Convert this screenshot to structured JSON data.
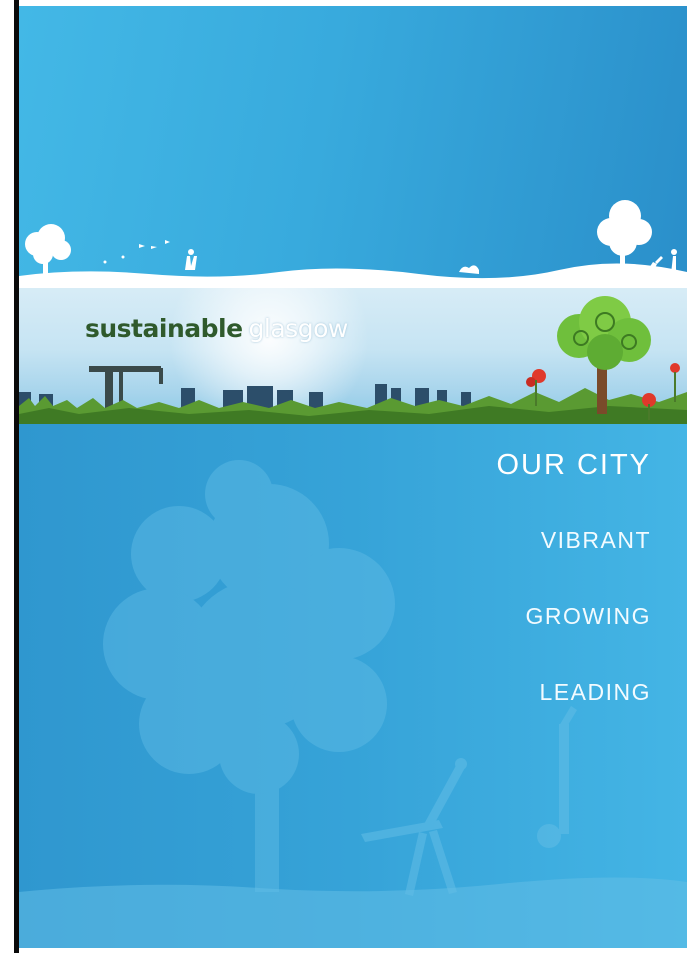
{
  "brand": {
    "word_1": "sustainable",
    "word_2": "glasgow"
  },
  "menu": {
    "heading": "OUR CITY",
    "items": [
      "VIBRANT",
      "GROWING",
      "LEADING"
    ]
  },
  "colors": {
    "sky_blue": "#38aadd",
    "lower_blue": "#36a3d8",
    "logo_green": "#2f5a2c",
    "tree_green": "#6fbf3c",
    "poppy_red": "#e0392b"
  },
  "icons": [
    "tree-silhouette-icon",
    "crane-icon",
    "city-skyline-icon",
    "tree-logo-icon",
    "poppy-icon",
    "cartwheel-figure-icon"
  ]
}
